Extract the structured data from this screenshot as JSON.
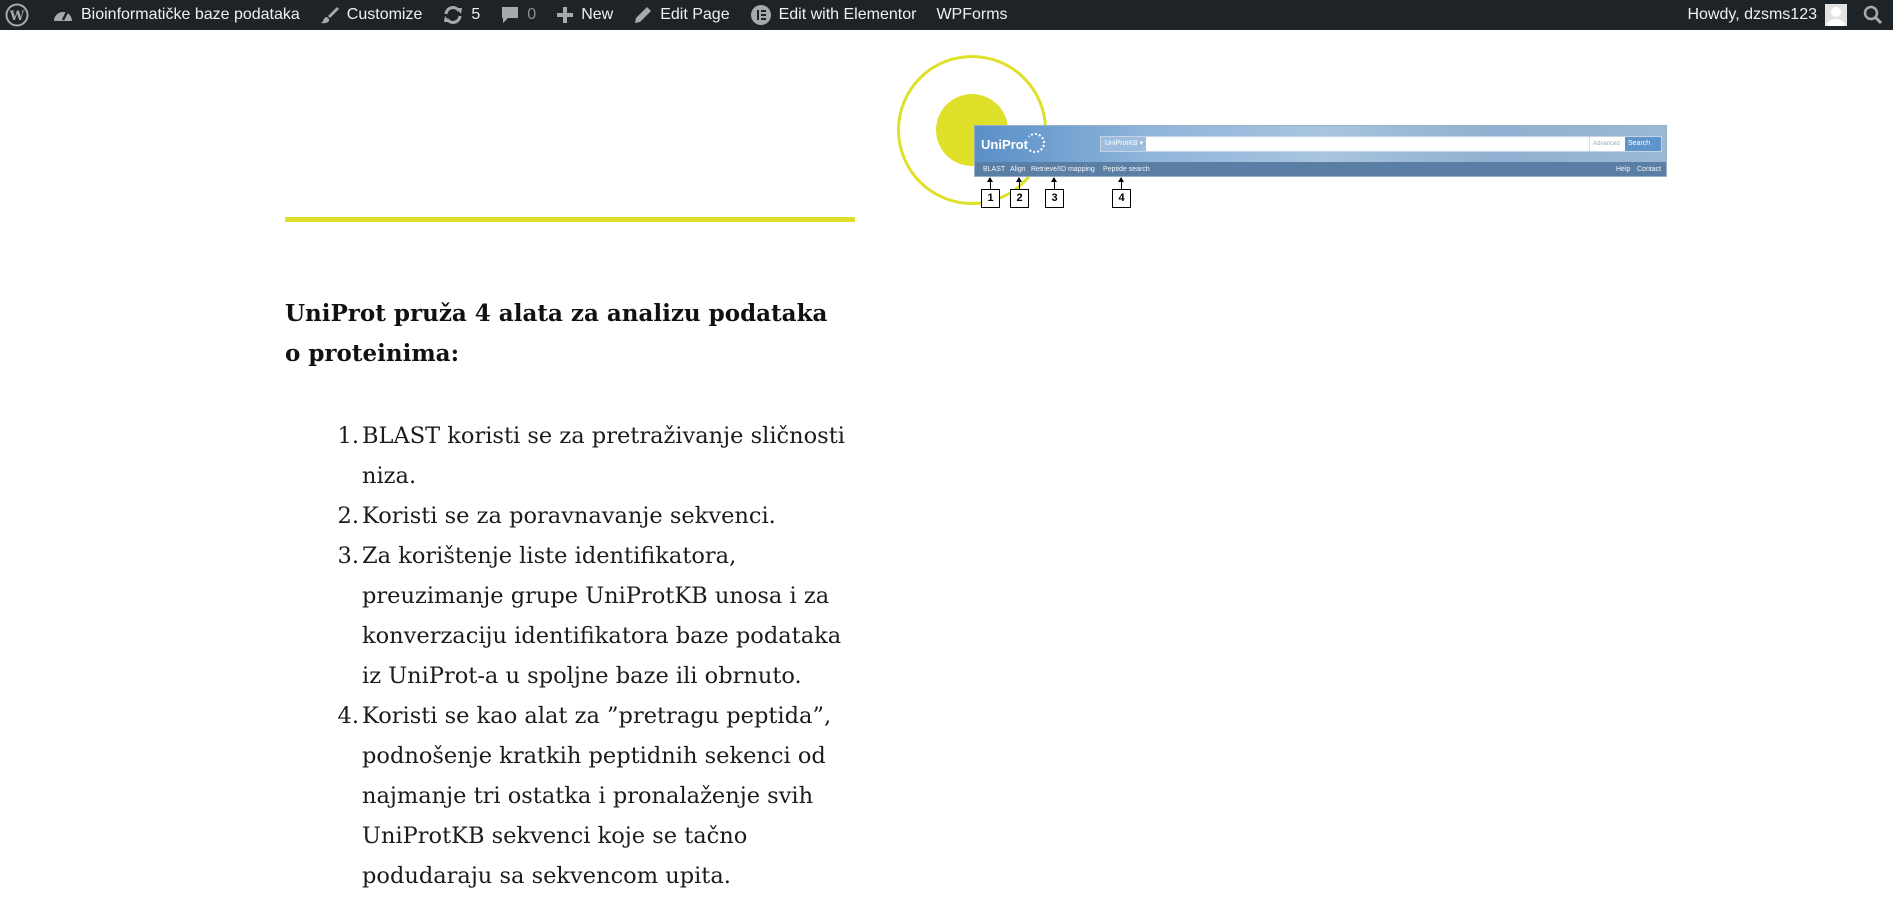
{
  "admin_bar": {
    "site_name": "Bioinformatičke baze podataka",
    "customize": "Customize",
    "updates_count": "5",
    "comments_count": "0",
    "new": "New",
    "edit_page": "Edit Page",
    "edit_elementor": "Edit with Elementor",
    "wpforms": "WPForms",
    "howdy": "Howdy, dzsms123",
    "icons": [
      "wordpress-logo-icon",
      "dashboard-icon",
      "brush-icon",
      "updates-icon",
      "comment-icon",
      "plus-icon",
      "pencil-icon",
      "elementor-icon",
      "user-avatar",
      "search-icon"
    ]
  },
  "uniprot_screenshot": {
    "logo": "UniProt",
    "search_scope": "UniProtKB ▾",
    "advanced": "Advanced ▾",
    "search_button": "Search",
    "nav": [
      "BLAST",
      "Align",
      "Retrieve/ID mapping",
      "Peptide search"
    ],
    "nav_right": [
      "Help",
      "Contact"
    ],
    "callouts": [
      "1",
      "2",
      "3",
      "4"
    ]
  },
  "content": {
    "intro": "UniProt pruža 4 alata za analizu podataka o proteinima:",
    "tools": [
      {
        "num": "1.",
        "text": "BLAST koristi se za pretraživanje sličnosti niza."
      },
      {
        "num": "2.",
        "text": "Koristi se za poravnavanje sekvenci."
      },
      {
        "num": "3.",
        "text": "Za korištenje liste identifikatora, preuzimanje grupe UniProtKB unosa i za konverzaciju identifikatora baze podataka iz UniProt-a u spoljne baze ili obrnuto."
      },
      {
        "num": "4.",
        "text": "Koristi se kao alat za ”pretragu peptida”, podnošenje kratkih peptidnih sekenci od najmanje tri ostatka i pronalaženje svih UniProtKB sekvenci koje se tačno podudaraju sa sekvencom upita."
      }
    ]
  },
  "colors": {
    "admin_bar_bg": "#1d2327",
    "accent_yellow": "#dfe02a",
    "uniprot_blue": "#6a95c2"
  }
}
